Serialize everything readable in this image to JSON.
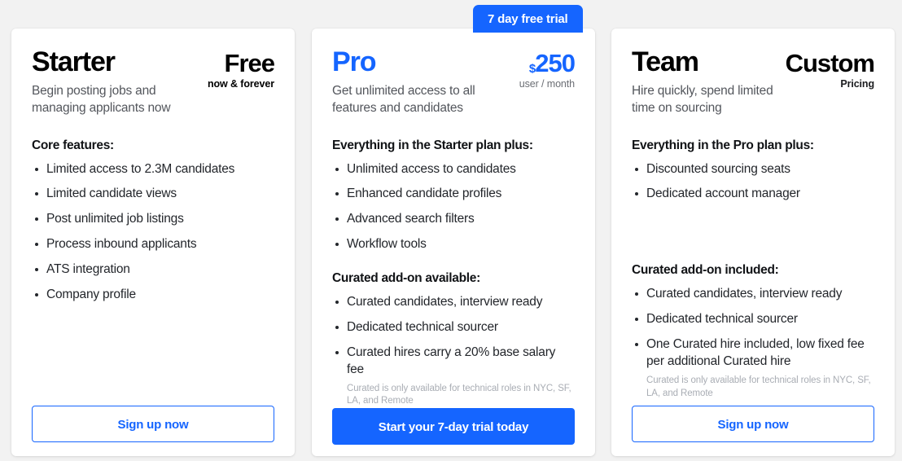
{
  "theme": {
    "accent": "#1565ff",
    "page_bg": "#f2f2f2",
    "card_bg": "#ffffff",
    "muted_text": "#53565c",
    "fineprint_text": "#a9adb4"
  },
  "badge": {
    "label": "7 day free trial"
  },
  "plans": [
    {
      "id": "starter",
      "name": "Starter",
      "description": "Begin posting jobs and managing applicants now",
      "price_currency": "",
      "price_main": "Free",
      "price_sub": "now & forever",
      "groups": [
        {
          "title": "Core features:",
          "items": [
            "Limited access to 2.3M candidates",
            "Limited candidate views",
            "Post unlimited job listings",
            "Process inbound applicants",
            "ATS integration",
            "Company profile"
          ],
          "fineprint": ""
        }
      ],
      "cta_label": "Sign up now",
      "cta_style": "outline"
    },
    {
      "id": "pro",
      "name": "Pro",
      "description": "Get unlimited access to all features and candidates",
      "price_currency": "$",
      "price_main": "250",
      "price_sub": "user / month",
      "groups": [
        {
          "title": "Everything in the Starter plan plus:",
          "items": [
            "Unlimited access to candidates",
            "Enhanced candidate profiles",
            "Advanced search filters",
            "Workflow tools"
          ],
          "fineprint": ""
        },
        {
          "title": "Curated add-on available:",
          "items": [
            "Curated candidates, interview ready",
            "Dedicated technical sourcer",
            "Curated hires carry a 20% base salary fee"
          ],
          "fineprint": "Curated is only available for technical roles in NYC, SF, LA, and Remote"
        }
      ],
      "cta_label": "Start your 7-day trial today",
      "cta_style": "filled"
    },
    {
      "id": "team",
      "name": "Team",
      "description": "Hire quickly, spend limited time on sourcing",
      "price_currency": "",
      "price_main": "Custom",
      "price_sub": "Pricing",
      "groups": [
        {
          "title": "Everything in the Pro plan plus:",
          "items": [
            "Discounted sourcing seats",
            "Dedicated account manager"
          ],
          "fineprint": ""
        },
        {
          "title": "Curated add-on included:",
          "items": [
            "Curated candidates, interview ready",
            "Dedicated technical sourcer",
            "One Curated hire included, low fixed fee per additional Curated hire"
          ],
          "fineprint": "Curated is only available for technical roles in NYC, SF, LA, and Remote"
        }
      ],
      "cta_label": "Sign up now",
      "cta_style": "outline"
    }
  ]
}
